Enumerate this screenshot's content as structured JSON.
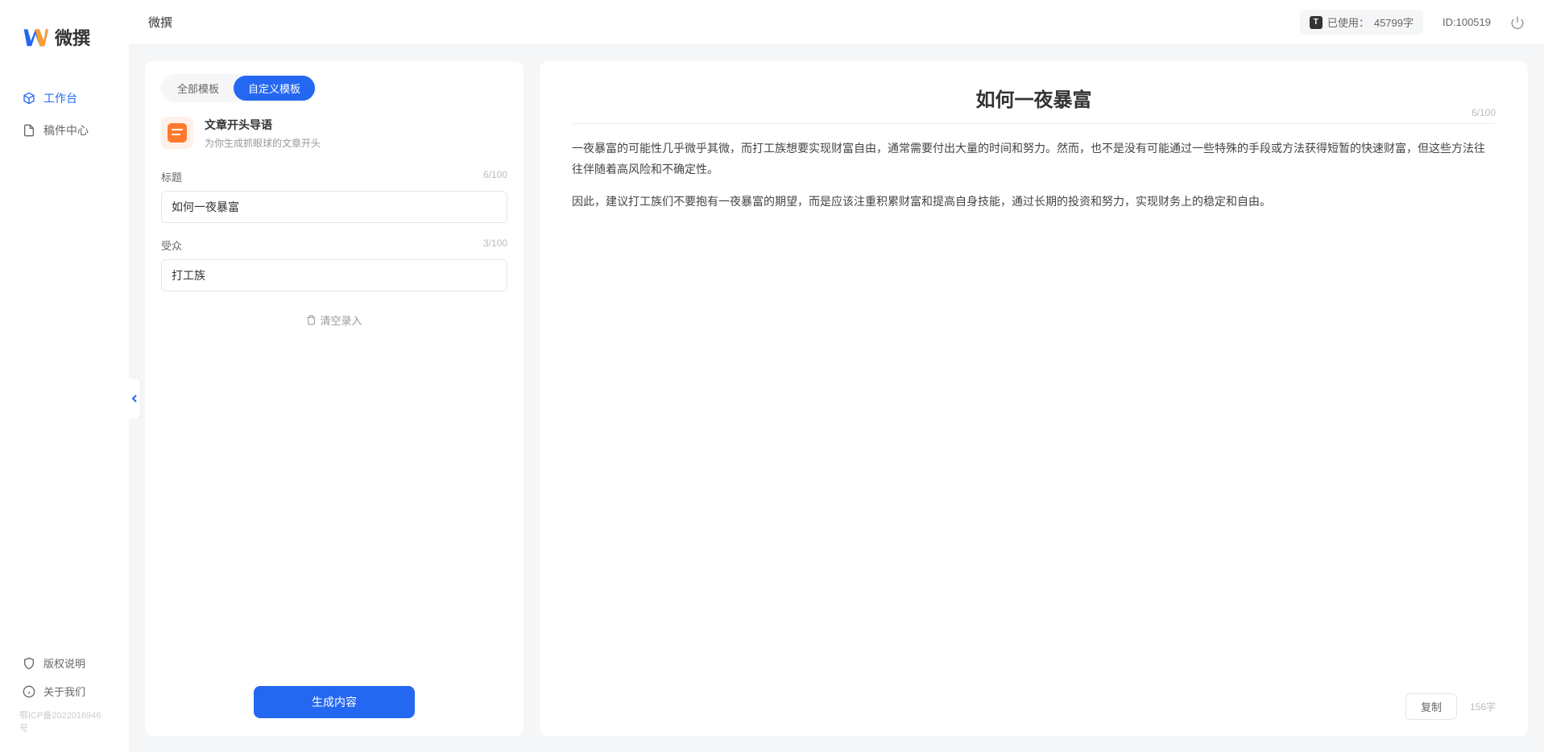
{
  "logo": {
    "text": "微撰"
  },
  "header": {
    "title": "微撰",
    "usage_label": "已使用：",
    "usage_value": "45799字",
    "user_id": "ID:100519"
  },
  "sidebar": {
    "items": [
      {
        "label": "工作台"
      },
      {
        "label": "稿件中心"
      }
    ],
    "bottom": [
      {
        "label": "版权说明"
      },
      {
        "label": "关于我们"
      }
    ],
    "icp": "鄂ICP备2022016946号"
  },
  "tabs": {
    "all": "全部模板",
    "custom": "自定义模板"
  },
  "template": {
    "title": "文章开头导语",
    "desc": "为你生成抓眼球的文章开头"
  },
  "form": {
    "title_label": "标题",
    "title_value": "如何一夜暴富",
    "title_count": "6/100",
    "audience_label": "受众",
    "audience_value": "打工族",
    "audience_count": "3/100",
    "clear_label": "清空录入",
    "generate_label": "生成内容"
  },
  "output": {
    "title": "如何一夜暴富",
    "title_count": "6/100",
    "paragraphs": [
      "一夜暴富的可能性几乎微乎其微，而打工族想要实现财富自由，通常需要付出大量的时间和努力。然而，也不是没有可能通过一些特殊的手段或方法获得短暂的快速财富，但这些方法往往伴随着高风险和不确定性。",
      "因此，建议打工族们不要抱有一夜暴富的期望，而是应该注重积累财富和提高自身技能，通过长期的投资和努力，实现财务上的稳定和自由。"
    ],
    "copy_label": "复制",
    "word_count": "156字"
  }
}
